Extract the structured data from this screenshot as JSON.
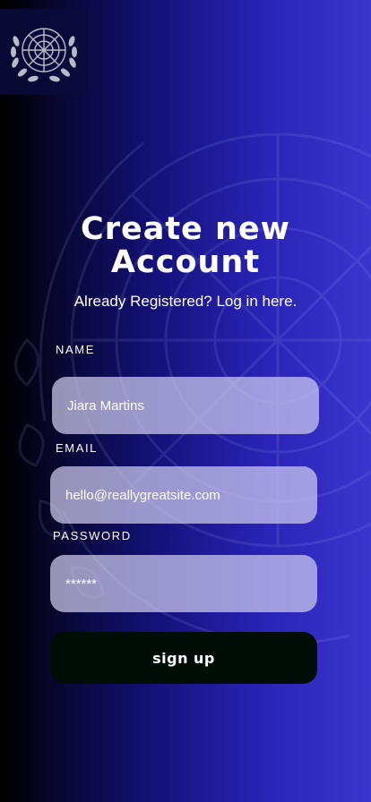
{
  "header": {
    "logo_icon": "un-emblem-icon"
  },
  "title": {
    "line1": "Create new",
    "line2": "Account"
  },
  "login_prompt": "Already Registered? Log in here.",
  "form": {
    "name": {
      "label": "NAME",
      "value": "Jiara Martins"
    },
    "email": {
      "label": "EMAIL",
      "value": "hello@reallygreatsite.com"
    },
    "password": {
      "label": "PASSWORD",
      "value": "******"
    },
    "submit_label": "sign up"
  },
  "colors": {
    "background_start": "#000000",
    "background_end": "#3a35cc",
    "field_fill": "#cecceeb8",
    "button_fill": "#000d07"
  }
}
